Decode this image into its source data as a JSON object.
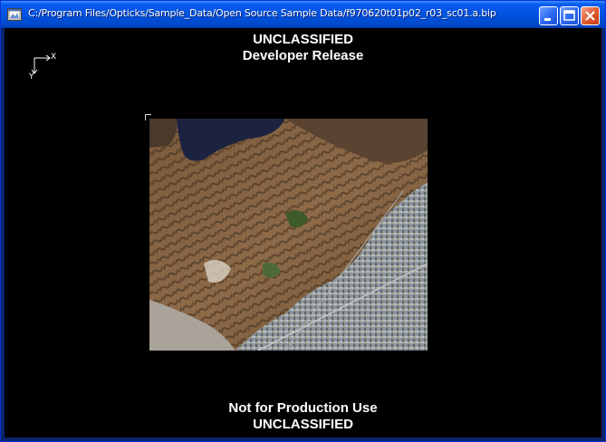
{
  "window": {
    "title": "C:/Program Files/Opticks/Sample_Data/Open Source Sample Data/f970620t01p02_r03_sc01.a.bip",
    "buttons": {
      "minimize": "minimize",
      "maximize": "maximize",
      "close": "close"
    }
  },
  "classification": {
    "top_line1": "UNCLASSIFIED",
    "top_line2": "Developer Release",
    "bottom_line1": "Not for Production Use",
    "bottom_line2": "UNCLASSIFIED"
  },
  "axis_indicator": {
    "x_label": "X",
    "y_label": "Y"
  },
  "icons": [
    "app-icon",
    "minimize-icon",
    "maximize-icon",
    "close-icon"
  ],
  "colors": {
    "titlebar": "#0053e1",
    "canvas": "#000000",
    "text": "#ffffff",
    "close_button": "#e1562a"
  }
}
